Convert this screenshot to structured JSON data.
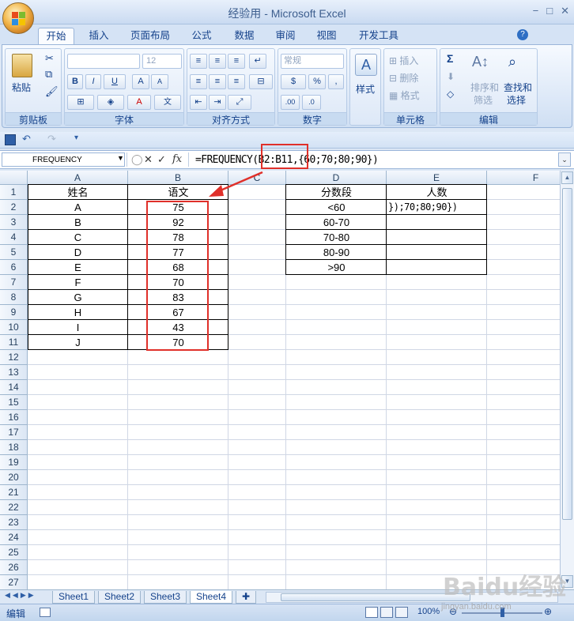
{
  "window": {
    "title": "经验用 - Microsoft Excel",
    "controls": [
      "−",
      "□",
      "✕"
    ]
  },
  "ribbon_tabs": [
    "开始",
    "插入",
    "页面布局",
    "公式",
    "数据",
    "审阅",
    "视图",
    "开发工具"
  ],
  "ribbon": {
    "font_size": "12",
    "number_format": "常规",
    "paste_label": "粘贴",
    "style_label": "样式",
    "insert_label": "插入",
    "delete_label": "删除",
    "format_label": "格式",
    "sort_label": "排序和",
    "sort_label2": "筛选",
    "find_label": "查找和",
    "find_label2": "选择",
    "groups": {
      "clipboard": "剪贴板",
      "font": "字体",
      "alignment": "对齐方式",
      "number": "数字",
      "cells": "单元格",
      "editing": "编辑"
    }
  },
  "formula_bar": {
    "name_box": "FREQUENCY",
    "fx": "fx",
    "formula": "=FREQUENCY(B2:B11,{60;70;80;90})"
  },
  "sheet": {
    "columns": [
      "A",
      "B",
      "C",
      "D",
      "E",
      "F"
    ],
    "rows": [
      "1",
      "2",
      "3",
      "4",
      "5",
      "6",
      "7",
      "8",
      "9",
      "10",
      "11",
      "12",
      "13",
      "14",
      "15",
      "16",
      "17",
      "18",
      "19",
      "20",
      "21",
      "22",
      "23",
      "24",
      "25",
      "26",
      "27"
    ],
    "col_a": [
      "姓名",
      "A",
      "B",
      "C",
      "D",
      "E",
      "F",
      "G",
      "H",
      "I",
      "J"
    ],
    "col_b": [
      "语文",
      "75",
      "92",
      "78",
      "77",
      "68",
      "70",
      "83",
      "67",
      "43",
      "70"
    ],
    "col_d": [
      "分数段",
      "<60",
      "60-70",
      "70-80",
      "80-90",
      ">90"
    ],
    "col_e_header": "人数",
    "e2_editing": "});70;80;90})"
  },
  "sheet_tabs": [
    "Sheet1",
    "Sheet2",
    "Sheet3",
    "Sheet4"
  ],
  "status": {
    "mode": "编辑",
    "zoom": "100%"
  },
  "watermark": {
    "logo": "Baidu经验",
    "url": "jingyan.baidu.com"
  }
}
